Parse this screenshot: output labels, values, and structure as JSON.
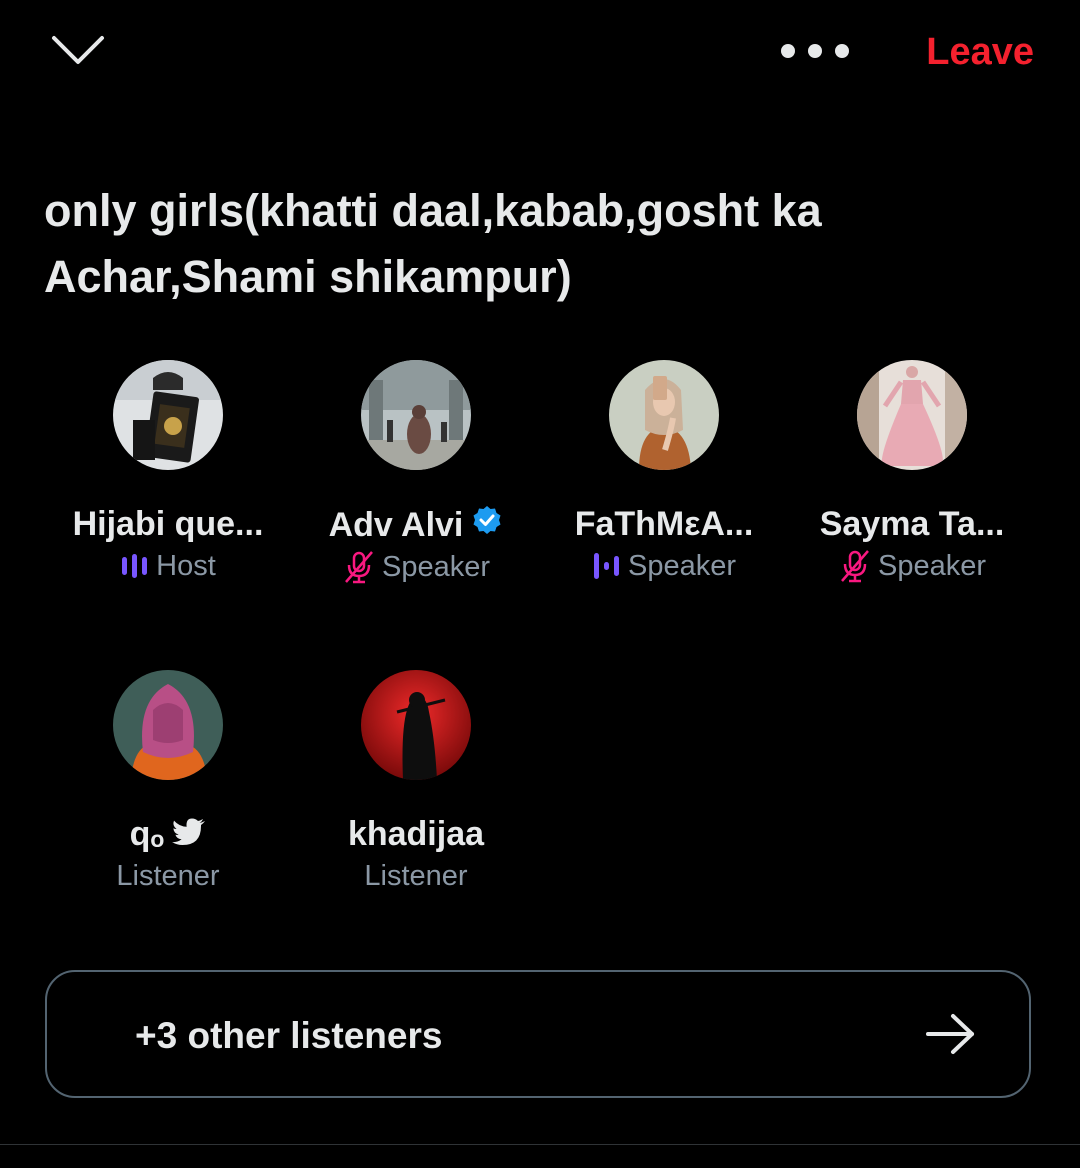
{
  "header": {
    "collapse_icon": "chevron-down-icon",
    "more_icon": "more-dots-icon",
    "leave_label": "Leave",
    "leave_color": "#f4212e"
  },
  "space": {
    "title": "only girls(khatti daal,kabab,gosht ka Achar,Shami shikampur)"
  },
  "participants": [
    {
      "name": "Hijabi que...",
      "role": "Host",
      "role_icon": "speaking-bars-icon",
      "verified": false
    },
    {
      "name": "Adv Alvi",
      "role": "Speaker",
      "role_icon": "mic-muted-icon",
      "verified": true
    },
    {
      "name": "FaThMεA...",
      "role": "Speaker",
      "role_icon": "speaking-bars-icon",
      "verified": false
    },
    {
      "name": "Sayma Ta...",
      "role": "Speaker",
      "role_icon": "mic-muted-icon",
      "verified": false
    },
    {
      "name": "qₒ",
      "role": "Listener",
      "role_icon": "",
      "verified": false,
      "name_icon": "bird-icon"
    },
    {
      "name": "khadijaa",
      "role": "Listener",
      "role_icon": "",
      "verified": false
    }
  ],
  "listeners_button": {
    "label": "+3 other listeners",
    "icon": "arrow-right-icon"
  },
  "colors": {
    "accent_purple": "#7856ff",
    "muted_pink": "#f91880",
    "verified_blue": "#1d9bf0"
  }
}
